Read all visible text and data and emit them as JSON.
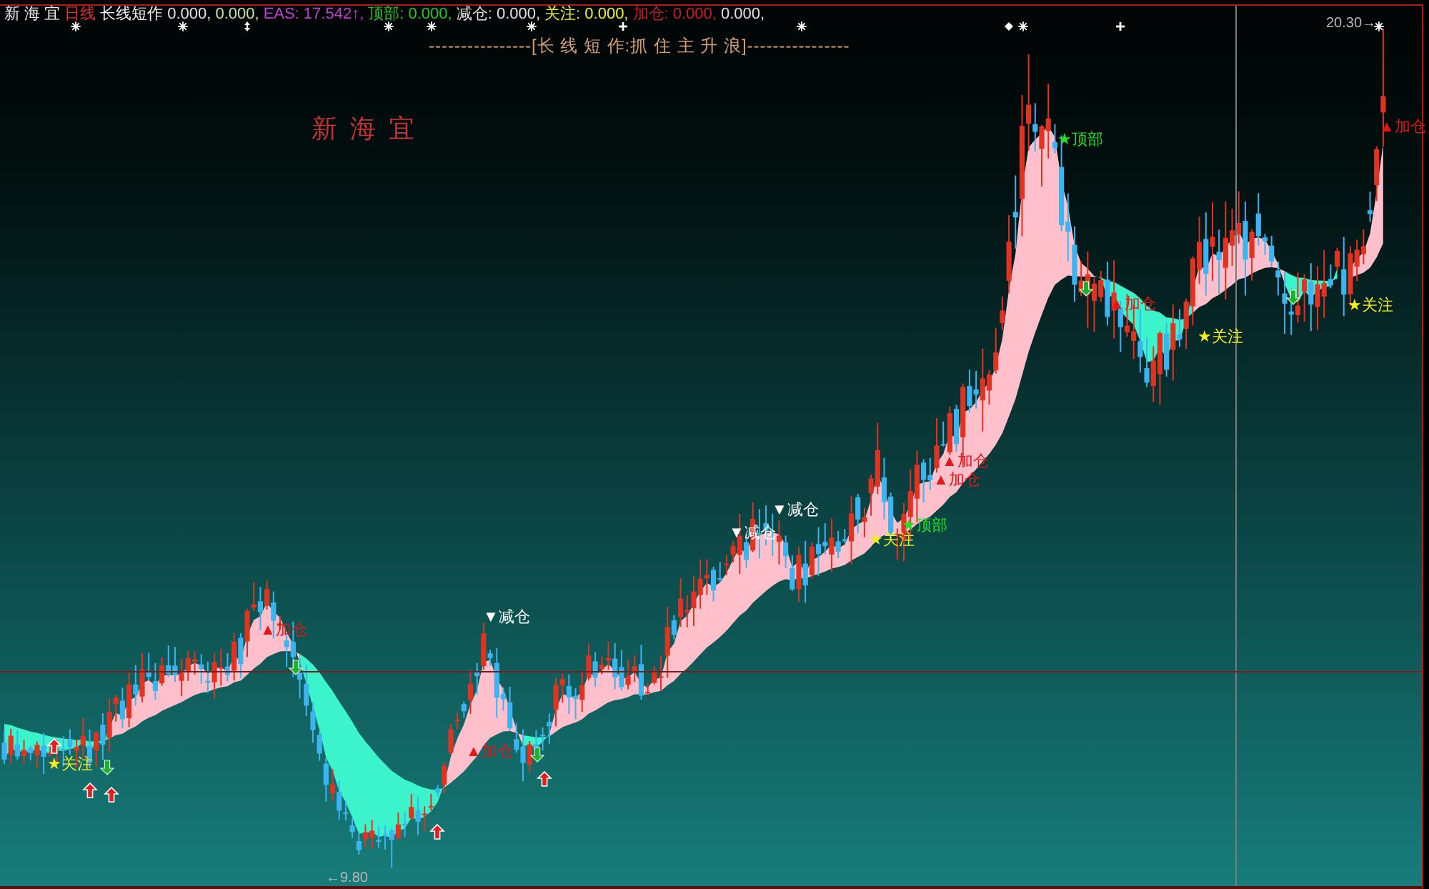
{
  "header": {
    "stock": "新 海 宜",
    "period": "日线",
    "indicator": "长线短作",
    "values": [
      {
        "text": "0.000,",
        "color": "#e0e0e0"
      },
      {
        "text": "0.000,",
        "color": "#c8e0a0"
      },
      {
        "text": "EAS: 17.542↑,",
        "color": "#c040d0"
      },
      {
        "text": "顶部: 0.000,",
        "color": "#20c820"
      },
      {
        "text": "减仓: 0.000,",
        "color": "#e0e0e0"
      },
      {
        "text": "关注: 0.000,",
        "color": "#f0f030"
      },
      {
        "text": "加仓: 0.000,",
        "color": "#c82020"
      },
      {
        "text": "0.000,",
        "color": "#e0e0e0"
      }
    ]
  },
  "chart": {
    "subtitle": "----------------[长 线 短 作:抓 住 主 升 浪]----------------",
    "stock_label": "新海宜",
    "high_label": "20.30→",
    "low_label": "←9.80",
    "signals": [
      {
        "text": "★关注",
        "kind": "watch"
      },
      {
        "text": "▲加仓",
        "kind": "add"
      },
      {
        "text": "▲加仓",
        "kind": "add"
      },
      {
        "text": "▼减仓",
        "kind": "reduce"
      },
      {
        "text": "▼减仓",
        "kind": "reduce"
      },
      {
        "text": "▼减仓",
        "kind": "reduce"
      },
      {
        "text": "★关注",
        "kind": "watch"
      },
      {
        "text": "★顶部",
        "kind": "top"
      },
      {
        "text": "▲加仓",
        "kind": "add"
      },
      {
        "text": "▲加仓",
        "kind": "add"
      },
      {
        "text": "★顶部",
        "kind": "top"
      },
      {
        "text": "▲加仓",
        "kind": "add"
      },
      {
        "text": "★关注",
        "kind": "watch"
      },
      {
        "text": "★关注",
        "kind": "watch"
      },
      {
        "text": "▲加仓",
        "kind": "add"
      }
    ]
  }
}
